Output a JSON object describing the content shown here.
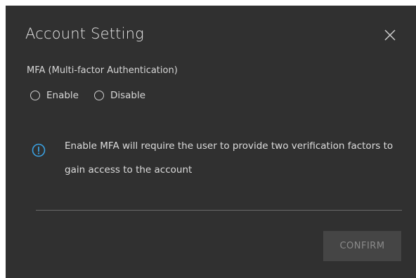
{
  "dialog": {
    "title": "Account Setting",
    "close_icon": "close-icon",
    "mfa": {
      "label": "MFA (Multi-factor Authentication)",
      "options": [
        {
          "label": "Enable",
          "selected": false
        },
        {
          "label": "Disable",
          "selected": false
        }
      ]
    },
    "info": {
      "icon": "info-icon",
      "icon_color": "#3aa0e0",
      "text": "Enable MFA will require the user to provide two verification factors to gain access to the account"
    },
    "confirm_label": "CONFIRM"
  },
  "colors": {
    "dialog_bg": "#303030",
    "button_bg": "#454545",
    "button_text": "#8a8a8a"
  }
}
